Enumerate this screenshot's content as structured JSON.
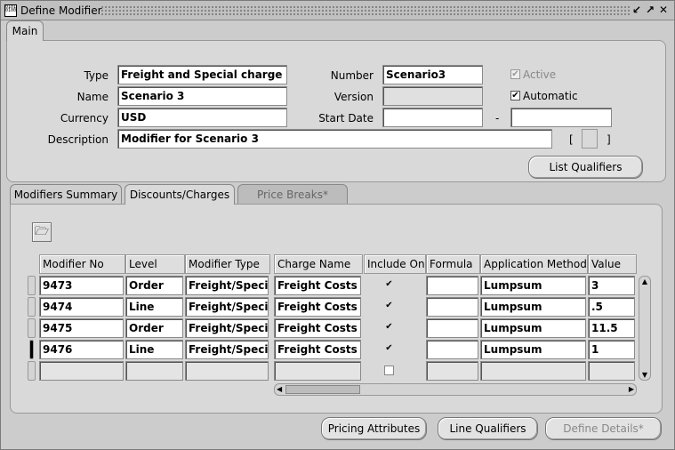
{
  "window": {
    "title": "Define Modifier",
    "icon_text": "0101\n0100"
  },
  "tabs": {
    "main": "Main"
  },
  "header": {
    "type_label": "Type",
    "type_value": "Freight and Special charge Li",
    "name_label": "Name",
    "name_value": "Scenario 3",
    "currency_label": "Currency",
    "currency_value": "USD",
    "description_label": "Description",
    "description_value": "Modifier for Scenario 3",
    "number_label": "Number",
    "number_value": "Scenario3",
    "version_label": "Version",
    "version_value": "",
    "start_date_label": "Start Date",
    "start_date_value": "",
    "end_date_value": "",
    "date_dash": "-",
    "active_label": "Active",
    "active_checked": true,
    "automatic_label": "Automatic",
    "automatic_checked": true,
    "flex_open": "[",
    "flex_close": "]",
    "list_qualifiers": "List Qualifiers"
  },
  "subtabs": {
    "summary": "Modifiers Summary",
    "discounts": "Discounts/Charges",
    "price_breaks": "Price Breaks*"
  },
  "table": {
    "headers": {
      "modifier_no": "Modifier No",
      "level": "Level",
      "modifier_type": "Modifier Type",
      "charge_name": "Charge Name",
      "include_on": "Include On",
      "formula": "Formula",
      "application_method": "Application Method",
      "value": "Value"
    },
    "rows": [
      {
        "modifier_no": "9473",
        "level": "Order",
        "modifier_type": "Freight/Specia",
        "charge_name": "Freight Costs",
        "include": true,
        "formula": "",
        "application_method": "Lumpsum",
        "value": "3"
      },
      {
        "modifier_no": "9474",
        "level": "Line",
        "modifier_type": "Freight/Specia",
        "charge_name": "Freight Costs",
        "include": true,
        "formula": "",
        "application_method": "Lumpsum",
        "value": ".5"
      },
      {
        "modifier_no": "9475",
        "level": "Order",
        "modifier_type": "Freight/Specia",
        "charge_name": "Freight Costs",
        "include": true,
        "formula": "",
        "application_method": "Lumpsum",
        "value": "11.5"
      },
      {
        "modifier_no": "9476",
        "level": "Line",
        "modifier_type": "Freight/Specia",
        "charge_name": "Freight Costs",
        "include": true,
        "formula": "",
        "application_method": "Lumpsum",
        "value": "1"
      },
      {
        "modifier_no": "",
        "level": "",
        "modifier_type": "",
        "charge_name": "",
        "include": false,
        "formula": "",
        "application_method": "",
        "value": ""
      }
    ]
  },
  "footer": {
    "pricing_attributes": "Pricing Attributes",
    "line_qualifiers": "Line Qualifiers",
    "define_details": "Define Details*"
  },
  "check_glyph": "✔"
}
